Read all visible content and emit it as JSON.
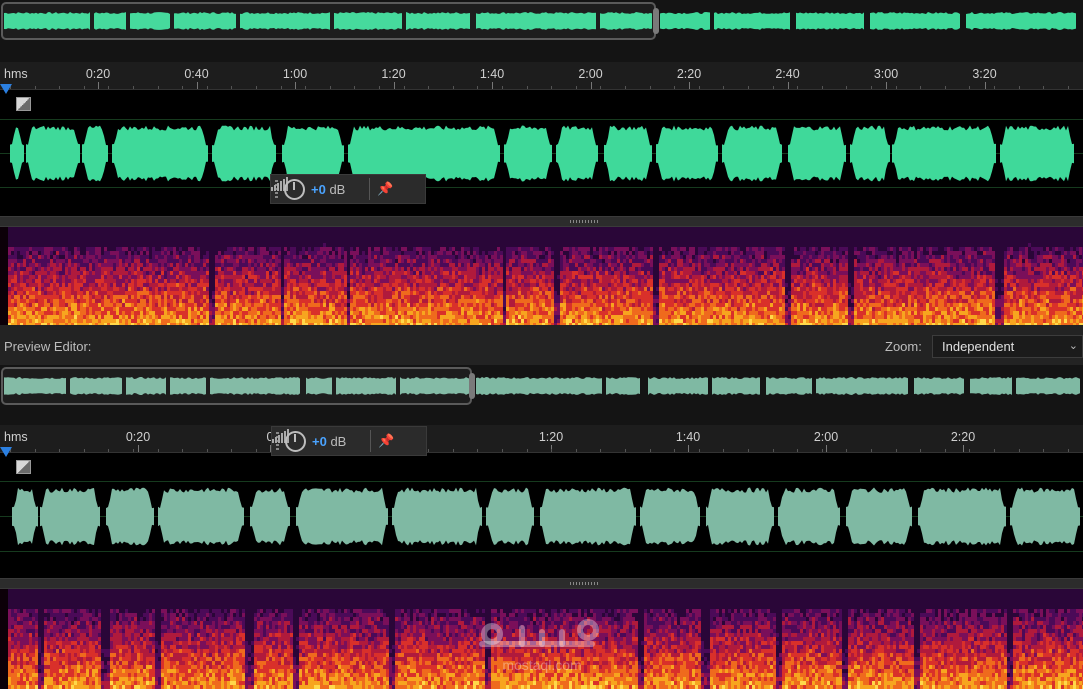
{
  "top_editor": {
    "ruler": {
      "unit": "hms",
      "labels": [
        "0:20",
        "0:40",
        "1:00",
        "1:20",
        "1:40",
        "2:00",
        "2:20",
        "2:40",
        "3:00",
        "3:20"
      ]
    },
    "volume_hud": {
      "value": "+0",
      "unit": "dB"
    }
  },
  "preview_bar": {
    "label": "Preview Editor:",
    "zoom_label": "Zoom:",
    "zoom_value": "Independent"
  },
  "bottom_editor": {
    "ruler": {
      "unit": "hms",
      "labels": [
        "0:20",
        "0",
        "1:20",
        "1:40",
        "2:00",
        "2:20"
      ]
    },
    "volume_hud": {
      "value": "+0",
      "unit": "dB"
    }
  },
  "watermark": {
    "text": "mostaql.com",
    "arabic": "مستقل"
  },
  "colors": {
    "waveform_top": "#3fd99a",
    "waveform_bottom": "#7fb9a3",
    "accent": "#2b7fe0",
    "hud_value": "#4aa3ff"
  },
  "icons": [
    "channel-toggle-icon",
    "level-meter-icon",
    "volume-knob-icon",
    "pin-icon",
    "playhead-marker-icon"
  ]
}
